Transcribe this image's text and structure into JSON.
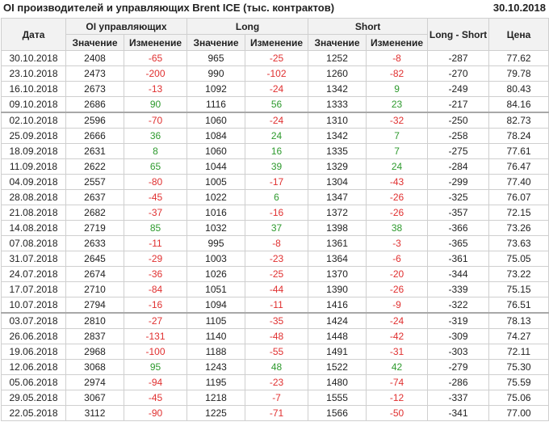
{
  "header": {
    "title": "OI производителей и управляющих Brent ICE (тыс. контрактов)",
    "date": "30.10.2018"
  },
  "colors": {
    "negative": "#e03030",
    "positive": "#2e9a2e"
  },
  "table": {
    "col_date": "Дата",
    "group_oi": "OI управляющих",
    "group_long": "Long",
    "group_short": "Short",
    "col_long_short": "Long - Short",
    "col_price": "Цена",
    "sub_value": "Значение",
    "sub_change": "Изменение",
    "rows": [
      {
        "date": "30.10.2018",
        "oi": "2408",
        "oi_ch": "-65",
        "long": "965",
        "long_ch": "-25",
        "short": "1252",
        "short_ch": "-8",
        "ls": "-287",
        "price": "77.62"
      },
      {
        "date": "23.10.2018",
        "oi": "2473",
        "oi_ch": "-200",
        "long": "990",
        "long_ch": "-102",
        "short": "1260",
        "short_ch": "-82",
        "ls": "-270",
        "price": "79.78"
      },
      {
        "date": "16.10.2018",
        "oi": "2673",
        "oi_ch": "-13",
        "long": "1092",
        "long_ch": "-24",
        "short": "1342",
        "short_ch": "9",
        "ls": "-249",
        "price": "80.43"
      },
      {
        "date": "09.10.2018",
        "oi": "2686",
        "oi_ch": "90",
        "long": "1116",
        "long_ch": "56",
        "short": "1333",
        "short_ch": "23",
        "ls": "-217",
        "price": "84.16"
      },
      {
        "date": "02.10.2018",
        "oi": "2596",
        "oi_ch": "-70",
        "long": "1060",
        "long_ch": "-24",
        "short": "1310",
        "short_ch": "-32",
        "ls": "-250",
        "price": "82.73",
        "sep": true
      },
      {
        "date": "25.09.2018",
        "oi": "2666",
        "oi_ch": "36",
        "long": "1084",
        "long_ch": "24",
        "short": "1342",
        "short_ch": "7",
        "ls": "-258",
        "price": "78.24"
      },
      {
        "date": "18.09.2018",
        "oi": "2631",
        "oi_ch": "8",
        "long": "1060",
        "long_ch": "16",
        "short": "1335",
        "short_ch": "7",
        "ls": "-275",
        "price": "77.61"
      },
      {
        "date": "11.09.2018",
        "oi": "2622",
        "oi_ch": "65",
        "long": "1044",
        "long_ch": "39",
        "short": "1329",
        "short_ch": "24",
        "ls": "-284",
        "price": "76.47"
      },
      {
        "date": "04.09.2018",
        "oi": "2557",
        "oi_ch": "-80",
        "long": "1005",
        "long_ch": "-17",
        "short": "1304",
        "short_ch": "-43",
        "ls": "-299",
        "price": "77.40"
      },
      {
        "date": "28.08.2018",
        "oi": "2637",
        "oi_ch": "-45",
        "long": "1022",
        "long_ch": "6",
        "short": "1347",
        "short_ch": "-26",
        "ls": "-325",
        "price": "76.07"
      },
      {
        "date": "21.08.2018",
        "oi": "2682",
        "oi_ch": "-37",
        "long": "1016",
        "long_ch": "-16",
        "short": "1372",
        "short_ch": "-26",
        "ls": "-357",
        "price": "72.15"
      },
      {
        "date": "14.08.2018",
        "oi": "2719",
        "oi_ch": "85",
        "long": "1032",
        "long_ch": "37",
        "short": "1398",
        "short_ch": "38",
        "ls": "-366",
        "price": "73.26"
      },
      {
        "date": "07.08.2018",
        "oi": "2633",
        "oi_ch": "-11",
        "long": "995",
        "long_ch": "-8",
        "short": "1361",
        "short_ch": "-3",
        "ls": "-365",
        "price": "73.63"
      },
      {
        "date": "31.07.2018",
        "oi": "2645",
        "oi_ch": "-29",
        "long": "1003",
        "long_ch": "-23",
        "short": "1364",
        "short_ch": "-6",
        "ls": "-361",
        "price": "75.05"
      },
      {
        "date": "24.07.2018",
        "oi": "2674",
        "oi_ch": "-36",
        "long": "1026",
        "long_ch": "-25",
        "short": "1370",
        "short_ch": "-20",
        "ls": "-344",
        "price": "73.22"
      },
      {
        "date": "17.07.2018",
        "oi": "2710",
        "oi_ch": "-84",
        "long": "1051",
        "long_ch": "-44",
        "short": "1390",
        "short_ch": "-26",
        "ls": "-339",
        "price": "75.15"
      },
      {
        "date": "10.07.2018",
        "oi": "2794",
        "oi_ch": "-16",
        "long": "1094",
        "long_ch": "-11",
        "short": "1416",
        "short_ch": "-9",
        "ls": "-322",
        "price": "76.51"
      },
      {
        "date": "03.07.2018",
        "oi": "2810",
        "oi_ch": "-27",
        "long": "1105",
        "long_ch": "-35",
        "short": "1424",
        "short_ch": "-24",
        "ls": "-319",
        "price": "78.13",
        "sep": true
      },
      {
        "date": "26.06.2018",
        "oi": "2837",
        "oi_ch": "-131",
        "long": "1140",
        "long_ch": "-48",
        "short": "1448",
        "short_ch": "-42",
        "ls": "-309",
        "price": "74.27"
      },
      {
        "date": "19.06.2018",
        "oi": "2968",
        "oi_ch": "-100",
        "long": "1188",
        "long_ch": "-55",
        "short": "1491",
        "short_ch": "-31",
        "ls": "-303",
        "price": "72.11"
      },
      {
        "date": "12.06.2018",
        "oi": "3068",
        "oi_ch": "95",
        "long": "1243",
        "long_ch": "48",
        "short": "1522",
        "short_ch": "42",
        "ls": "-279",
        "price": "75.30"
      },
      {
        "date": "05.06.2018",
        "oi": "2974",
        "oi_ch": "-94",
        "long": "1195",
        "long_ch": "-23",
        "short": "1480",
        "short_ch": "-74",
        "ls": "-286",
        "price": "75.59"
      },
      {
        "date": "29.05.2018",
        "oi": "3067",
        "oi_ch": "-45",
        "long": "1218",
        "long_ch": "-7",
        "short": "1555",
        "short_ch": "-12",
        "ls": "-337",
        "price": "75.06"
      },
      {
        "date": "22.05.2018",
        "oi": "3112",
        "oi_ch": "-90",
        "long": "1225",
        "long_ch": "-71",
        "short": "1566",
        "short_ch": "-50",
        "ls": "-341",
        "price": "77.00"
      }
    ]
  }
}
